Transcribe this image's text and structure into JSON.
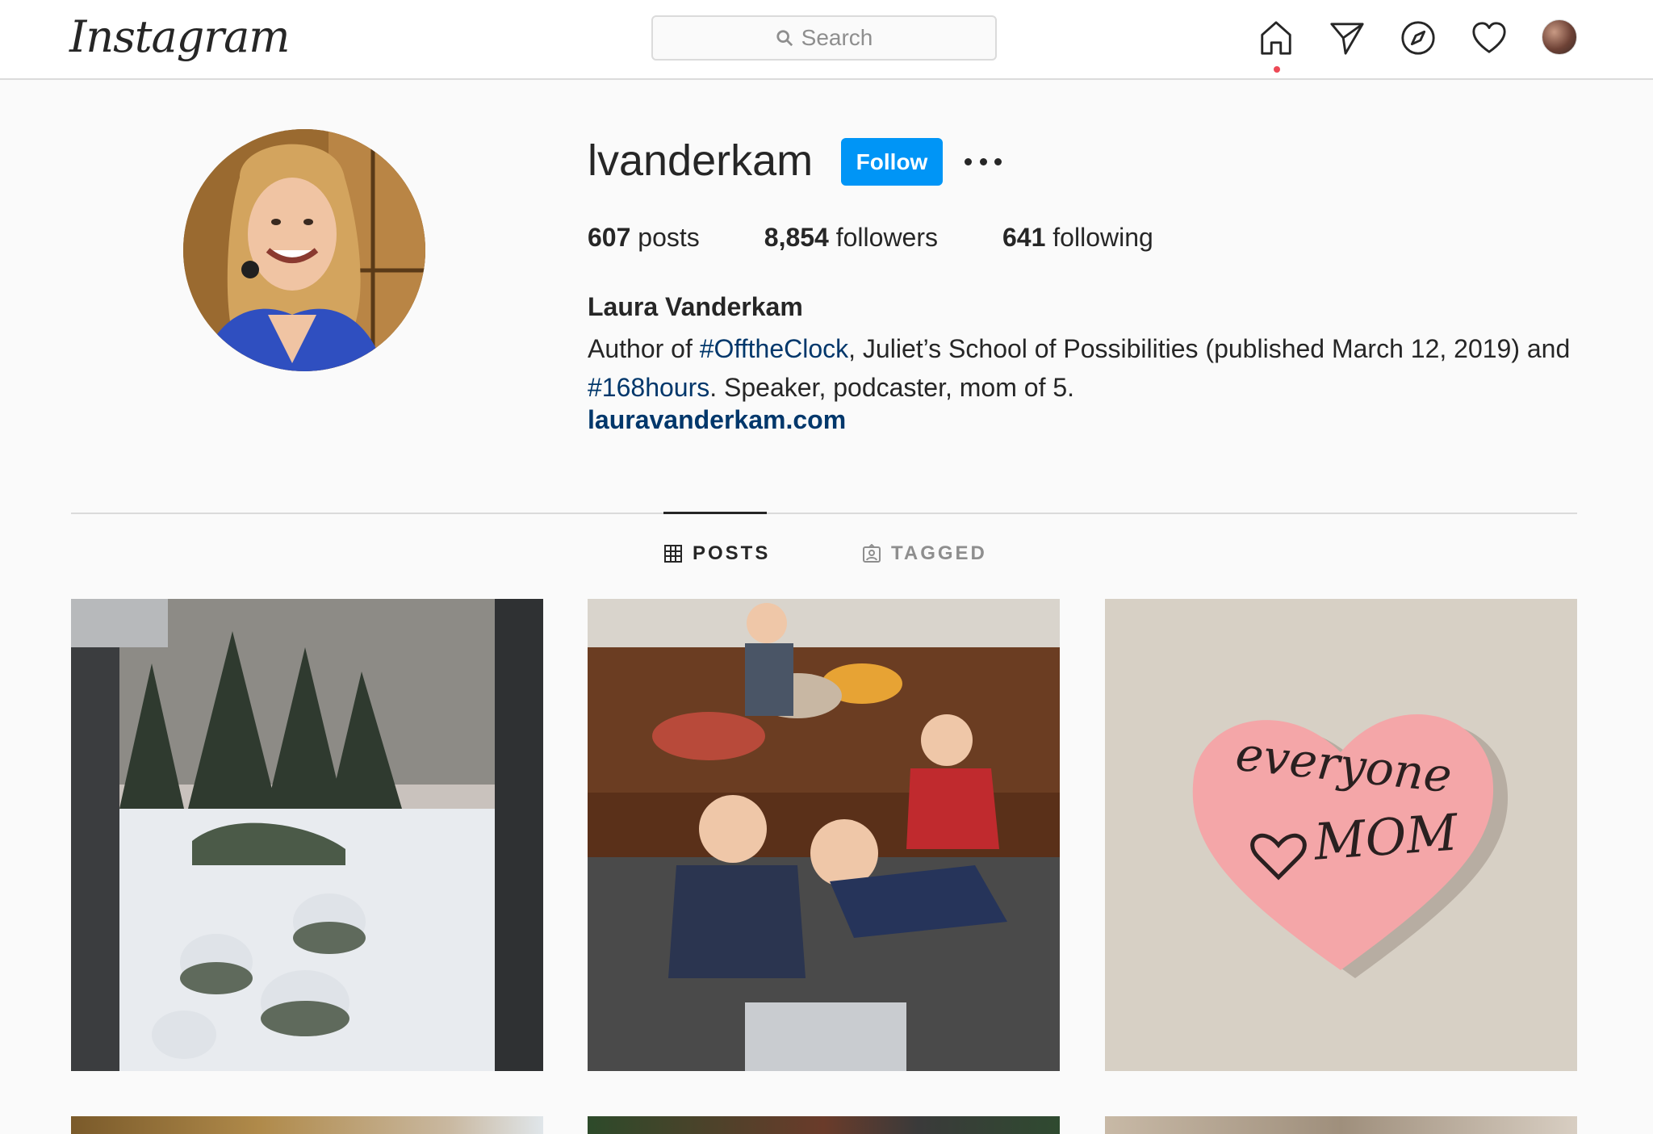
{
  "app": {
    "logo": "Instagram"
  },
  "search": {
    "placeholder": "Search"
  },
  "nav": {
    "icons": [
      "home-icon",
      "direct-icon",
      "explore-icon",
      "activity-icon",
      "profile-avatar"
    ]
  },
  "profile": {
    "username": "lvanderkam",
    "follow_label": "Follow",
    "stats": {
      "posts_count": "607",
      "posts_label": "posts",
      "followers_count": "8,854",
      "followers_label": "followers",
      "following_count": "641",
      "following_label": "following"
    },
    "full_name": "Laura Vanderkam",
    "bio": {
      "part1": "Author of ",
      "tag1": "#OfftheClock",
      "part2": ", Juliet’s School of Possibilities (published March 12, 2019) and ",
      "tag2": "#168hours",
      "part3": ". Speaker, podcaster, mom of 5."
    },
    "website": "lauravanderkam.com"
  },
  "tabs": [
    {
      "label": "POSTS",
      "icon": "grid-icon",
      "active": true
    },
    {
      "label": "TAGGED",
      "icon": "tagged-icon",
      "active": false
    }
  ],
  "posts": [
    {
      "subject": "snowy-yard-through-window"
    },
    {
      "subject": "kids-on-couch-with-laptop"
    },
    {
      "subject": "heart-sticky-note",
      "note_line1": "everyone",
      "note_line2": "MOM"
    }
  ],
  "colors": {
    "accent": "#0095f6",
    "link": "#00376b",
    "notification_dot": "#ed4956"
  }
}
